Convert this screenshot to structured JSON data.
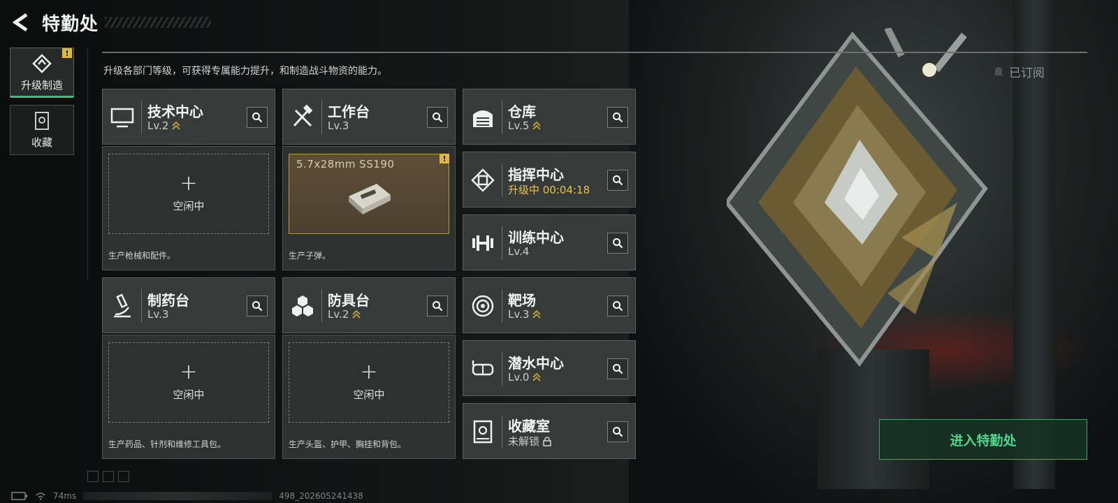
{
  "header": {
    "title": "特勤处",
    "subtitle": "升级各部门等级，可获得专属能力提升，和制造战斗物资的能力。",
    "subscribed_label": "已订阅"
  },
  "side_tabs": [
    {
      "label": "升级制造",
      "icon": "upgrade-craft-icon",
      "active": true,
      "badge": "!"
    },
    {
      "label": "收藏",
      "icon": "collection-icon",
      "active": false
    }
  ],
  "workshops": [
    {
      "name": "技术中心",
      "level": "Lv.2",
      "icon": "computer-monitor-icon",
      "upgradable": true,
      "slot": {
        "plus": "+",
        "state": "空闲中"
      },
      "description": "生产枪械和配件。"
    },
    {
      "name": "工作台",
      "level": "Lv.3",
      "icon": "hammer-wrench-icon",
      "upgradable": false,
      "slot": {
        "item": "5.7x28mm SS190",
        "badge": "!"
      },
      "description": "生产子弹。"
    },
    {
      "name": "制药台",
      "level": "Lv.3",
      "icon": "microscope-icon",
      "upgradable": false,
      "slot": {
        "plus": "+",
        "state": "空闲中"
      },
      "description": "生产药品、针剂和维修工具包。"
    },
    {
      "name": "防具台",
      "level": "Lv.2",
      "icon": "hexagon-cluster-icon",
      "upgradable": true,
      "slot": {
        "plus": "+",
        "state": "空闲中"
      },
      "description": "生产头盔、护甲、胸挂和背包。"
    }
  ],
  "facilities": [
    {
      "name": "仓库",
      "level": "Lv.5",
      "icon": "warehouse-icon",
      "upgradable": true
    },
    {
      "name": "指挥中心",
      "status": "升级中 00:04:18",
      "icon": "command-chip-icon",
      "upgrading": true
    },
    {
      "name": "训练中心",
      "level": "Lv.4",
      "icon": "dumbbell-icon",
      "upgradable": false
    },
    {
      "name": "靶场",
      "level": "Lv.3",
      "icon": "target-icon",
      "upgradable": true
    },
    {
      "name": "潜水中心",
      "level": "Lv.0",
      "icon": "diving-mask-icon",
      "upgradable": true
    },
    {
      "name": "收藏室",
      "status": "未解锁",
      "icon": "vault-icon",
      "locked": true
    }
  ],
  "enter_button": "进入特勤处",
  "status_bar": {
    "ping": "74ms",
    "build": "498_202605241438"
  },
  "colors": {
    "accent_green": "#3fc07a",
    "upgrade_gold": "#e7c24b",
    "warning_yellow": "#e0b73a"
  }
}
